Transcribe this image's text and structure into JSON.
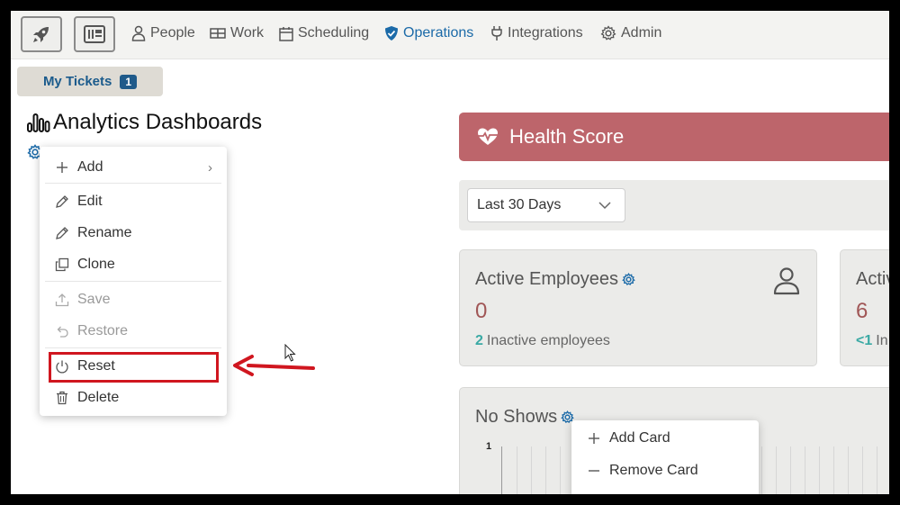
{
  "nav": {
    "items": [
      {
        "label": "People",
        "icon": "person-icon"
      },
      {
        "label": "Work",
        "icon": "work-icon"
      },
      {
        "label": "Scheduling",
        "icon": "calendar-icon"
      },
      {
        "label": "Operations",
        "icon": "shield-icon",
        "active": true
      },
      {
        "label": "Integrations",
        "icon": "plug-icon"
      },
      {
        "label": "Admin",
        "icon": "gear-icon"
      }
    ]
  },
  "tickets": {
    "label": "My Tickets",
    "count": "1"
  },
  "dashboard": {
    "title": "Analytics Dashboards"
  },
  "context_menu": {
    "items": [
      {
        "label": "Add",
        "icon": "plus-icon",
        "submenu": true
      },
      {
        "label": "Edit",
        "icon": "pencil-icon"
      },
      {
        "label": "Rename",
        "icon": "pencil-icon"
      },
      {
        "label": "Clone",
        "icon": "copy-icon"
      },
      {
        "label": "Save",
        "icon": "upload-icon",
        "disabled": true
      },
      {
        "label": "Restore",
        "icon": "undo-icon",
        "disabled": true
      },
      {
        "label": "Reset",
        "icon": "power-icon",
        "highlighted": true
      },
      {
        "label": "Delete",
        "icon": "trash-icon"
      }
    ]
  },
  "health": {
    "title": "Health Score"
  },
  "filter": {
    "range": "Last 30 Days"
  },
  "cards": {
    "active_employees": {
      "title": "Active Employees",
      "value": "0",
      "sub_count": "2",
      "sub_label": "Inactive employees"
    },
    "second": {
      "title": "Activ",
      "value": "6",
      "sub_count": "<1",
      "sub_label": "In"
    }
  },
  "no_shows": {
    "title": "No Shows",
    "y_tick": "1"
  },
  "card_menu": {
    "items": [
      {
        "label": "Add Card",
        "icon": "plus-icon"
      },
      {
        "label": "Remove Card",
        "icon": "minus-icon"
      }
    ]
  },
  "colors": {
    "accent": "#1b6aa8",
    "health": "#bd656b",
    "highlight": "#d0161f",
    "value": "#a05656"
  }
}
